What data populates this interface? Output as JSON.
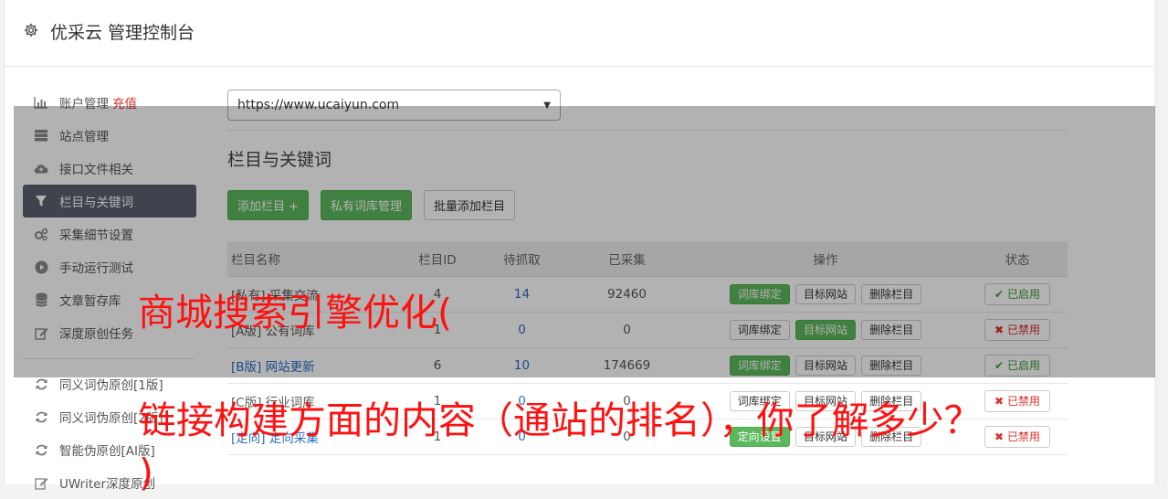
{
  "header": {
    "title": "优采云 管理控制台",
    "icon": "gear-icon"
  },
  "sidebar": {
    "items": [
      {
        "label": "账户管理",
        "extra": "充值",
        "icon": "bar-chart-icon"
      },
      {
        "label": "站点管理",
        "icon": "server-icon"
      },
      {
        "label": "接口文件相关",
        "icon": "cloud-upload-icon"
      },
      {
        "label": "栏目与关键词",
        "icon": "filter-icon",
        "active": true
      },
      {
        "label": "采集细节设置",
        "icon": "cogs-icon"
      },
      {
        "label": "手动运行测试",
        "icon": "play-circle-icon"
      },
      {
        "label": "文章暂存库",
        "icon": "database-icon"
      },
      {
        "label": "深度原创任务",
        "icon": "edit-icon"
      },
      {
        "label": "同义词伪原创[1版]",
        "icon": "refresh-icon"
      },
      {
        "label": "同义词伪原创[2版]",
        "icon": "refresh-icon"
      },
      {
        "label": "智能伪原创[AI版]",
        "icon": "refresh-icon"
      },
      {
        "label": "UWriter深度原创",
        "icon": "edit-icon"
      }
    ]
  },
  "main": {
    "site_select": "https://www.ucaiyun.com",
    "section_title": "栏目与关键词",
    "buttons": {
      "add": "添加栏目 +",
      "private_lib": "私有词库管理",
      "batch_add": "批量添加栏目"
    },
    "table": {
      "headers": [
        "栏目名称",
        "栏目ID",
        "待抓取",
        "已采集",
        "操作",
        "状态"
      ],
      "op_labels": {
        "bind": "词库绑定",
        "target": "目标网站",
        "delete": "删除栏目"
      },
      "rows": [
        {
          "tag": "[私有]",
          "name": "采集交流",
          "id": "4",
          "pending": "14",
          "collected": "92460",
          "status": "已启用"
        },
        {
          "tag": "[A版]",
          "name": "公有词库",
          "id": "1",
          "pending": "0",
          "collected": "0",
          "status": "已禁用"
        },
        {
          "tag": "[B版]",
          "name": "网站更新",
          "id": "6",
          "pending": "10",
          "collected": "174669",
          "status": "已启用"
        },
        {
          "tag": "[C版]",
          "name": "行业词库",
          "id": "1",
          "pending": "0",
          "collected": "0",
          "status": "已禁用"
        },
        {
          "tag": "[定向]",
          "name": "定向采集",
          "id": "1",
          "pending": "0",
          "collected": "0",
          "status": "已禁用",
          "first_op": "定向设置"
        }
      ]
    }
  },
  "captions": {
    "line1": "商城搜索引擎优化(",
    "line2": "链接构建方面的内容（通站的排名），你了解多少？",
    "line3": ")"
  }
}
